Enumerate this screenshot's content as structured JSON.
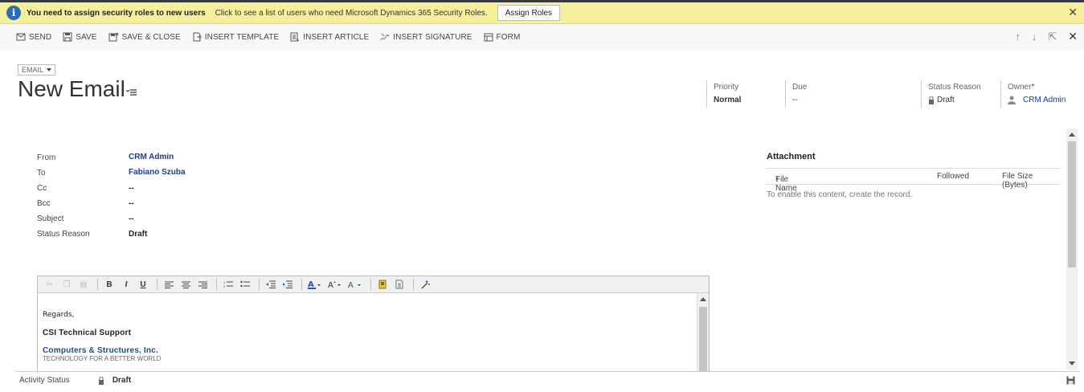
{
  "notification": {
    "message": "You need to assign security roles to new users",
    "detail": "Click to see a list of users who need Microsoft Dynamics 365 Security Roles.",
    "button": "Assign Roles",
    "close": "✕"
  },
  "commands": [
    {
      "label": "SEND",
      "icon": "send-icon"
    },
    {
      "label": "SAVE",
      "icon": "save-icon"
    },
    {
      "label": "SAVE & CLOSE",
      "icon": "save-close-icon"
    },
    {
      "label": "INSERT TEMPLATE",
      "icon": "insert-template-icon"
    },
    {
      "label": "INSERT ARTICLE",
      "icon": "insert-article-icon"
    },
    {
      "label": "INSERT SIGNATURE",
      "icon": "insert-signature-icon"
    },
    {
      "label": "FORM",
      "icon": "form-icon"
    }
  ],
  "nav": {
    "up": "↑",
    "down": "↓",
    "popout": "⇱",
    "close": "✕"
  },
  "header": {
    "entity": "EMAIL",
    "title": "New Email",
    "fields": [
      {
        "label": "Priority",
        "value": "Normal"
      },
      {
        "label": "Due",
        "value": "--"
      },
      {
        "label": "Status Reason",
        "value": "Draft"
      },
      {
        "label": "Owner",
        "value": "CRM Admin",
        "required": "*"
      }
    ]
  },
  "form": {
    "from": {
      "label": "From",
      "value": "CRM Admin"
    },
    "to": {
      "label": "To",
      "value": "Fabiano Szuba"
    },
    "cc": {
      "label": "Cc",
      "value": "--"
    },
    "bcc": {
      "label": "Bcc",
      "value": "--"
    },
    "subject": {
      "label": "Subject",
      "value": "--"
    },
    "status_reason": {
      "label": "Status Reason",
      "value": "Draft"
    }
  },
  "attachment": {
    "title": "Attachment",
    "columns": [
      "File Name",
      "Followed",
      "File Size (Bytes)"
    ],
    "sort_arrow": "↑",
    "empty_text": "To enable this content, create the record."
  },
  "editor": {
    "toolbar": {
      "bold": "B",
      "italic": "I",
      "underline": "U"
    },
    "body": {
      "regards": "Regards,",
      "sig_name": "CSI Technical Support",
      "sig_company": "Computers & Structures, Inc.",
      "sig_tagline": "TECHNOLOGY FOR A BETTER WORLD"
    }
  },
  "footer": {
    "label": "Activity Status",
    "value": "Draft"
  },
  "colors": {
    "notification_bg": "#f6ef9c",
    "link": "#1a3c8c",
    "info_icon": "#2e6db4"
  }
}
